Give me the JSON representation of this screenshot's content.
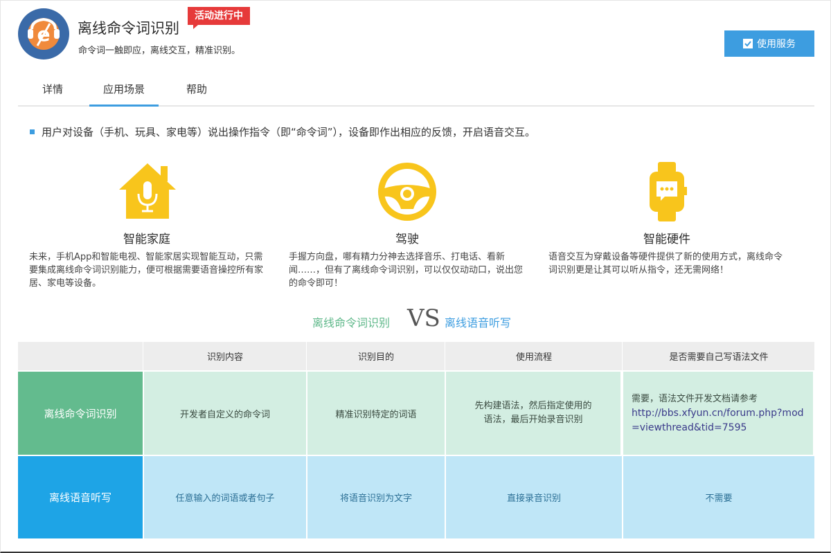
{
  "header": {
    "title": "离线命令词识别",
    "badge": "活动进行中",
    "subtitle": "命令词一触即应，离线交互，精准识别。",
    "use_button": "使用服务"
  },
  "tabs": [
    {
      "label": "详情"
    },
    {
      "label": "应用场景"
    },
    {
      "label": "帮助"
    }
  ],
  "intro": "用户对设备（手机、玩具、家电等）说出操作指令（即“命令词”），设备即作出相应的反馈，开启语音交互。",
  "scenarios": [
    {
      "title": "智能家庭",
      "desc": "未来，手机App和智能电视、智能家居实现智能互动，只需要集成离线命令词识别能力，便可根据需要语音操控所有家居、家电等设备。"
    },
    {
      "title": "驾驶",
      "desc": "手握方向盘，哪有精力分神去选择音乐、打电话、看新闻……，但有了离线命令词识别，可以仅仅动动口，说出您的命令即可！"
    },
    {
      "title": "智能硬件",
      "desc": "语音交互为穿戴设备等硬件提供了新的使用方式，离线命令词识别更是让其可以听从指令，还无需网络！"
    }
  ],
  "vs": {
    "left": "离线命令词识别",
    "mid": "VS",
    "right": "离线语音听写"
  },
  "table": {
    "headers": [
      "",
      "识别内容",
      "识别目的",
      "使用流程",
      "是否需要自己写语法文件"
    ],
    "rows": [
      {
        "label": "离线命令词识别",
        "cells": [
          "开发者自定义的命令词",
          "精准识别特定的词语",
          "先构建语法，然后指定使用的语法，最后开始录音识别"
        ],
        "last_text": "需要，语法文件开发文档请参考",
        "last_link": "http://bbs.xfyun.cn/forum.php?mod=viewthread&tid=7595"
      },
      {
        "label": "离线语音听写",
        "cells": [
          "任意输入的词语或者句子",
          "将语音识别为文字",
          "直接录音识别"
        ],
        "last_text": "不需要"
      }
    ]
  },
  "colors": {
    "accent": "#3d9de0",
    "badge": "#e63a3a",
    "icon_yellow": "#f8c51c",
    "green": "#63bb8e",
    "blue": "#1ea4e6"
  }
}
